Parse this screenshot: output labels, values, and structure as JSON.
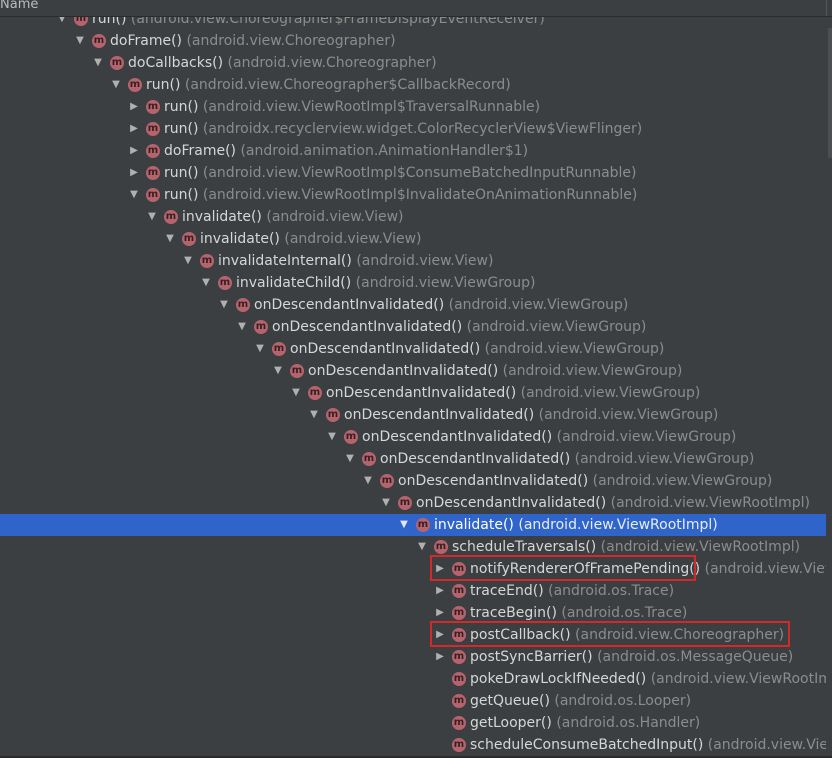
{
  "header": {
    "column": "Name"
  },
  "rows": [
    {
      "depth": 0,
      "exp": "open",
      "method": "run()",
      "cls": "(android.view.Choreographer$FrameDisplayEventReceiver)"
    },
    {
      "depth": 1,
      "exp": "open",
      "method": "doFrame()",
      "cls": "(android.view.Choreographer)"
    },
    {
      "depth": 2,
      "exp": "open",
      "method": "doCallbacks()",
      "cls": "(android.view.Choreographer)"
    },
    {
      "depth": 3,
      "exp": "open",
      "method": "run()",
      "cls": "(android.view.Choreographer$CallbackRecord)"
    },
    {
      "depth": 4,
      "exp": "closed",
      "method": "run()",
      "cls": "(android.view.ViewRootImpl$TraversalRunnable)"
    },
    {
      "depth": 4,
      "exp": "closed",
      "method": "run()",
      "cls": "(androidx.recyclerview.widget.ColorRecyclerView$ViewFlinger)"
    },
    {
      "depth": 4,
      "exp": "closed",
      "method": "doFrame()",
      "cls": "(android.animation.AnimationHandler$1)"
    },
    {
      "depth": 4,
      "exp": "closed",
      "method": "run()",
      "cls": "(android.view.ViewRootImpl$ConsumeBatchedInputRunnable)"
    },
    {
      "depth": 4,
      "exp": "open",
      "method": "run()",
      "cls": "(android.view.ViewRootImpl$InvalidateOnAnimationRunnable)"
    },
    {
      "depth": 5,
      "exp": "open",
      "method": "invalidate()",
      "cls": "(android.view.View)"
    },
    {
      "depth": 6,
      "exp": "open",
      "method": "invalidate()",
      "cls": "(android.view.View)"
    },
    {
      "depth": 7,
      "exp": "open",
      "method": "invalidateInternal()",
      "cls": "(android.view.View)"
    },
    {
      "depth": 8,
      "exp": "open",
      "method": "invalidateChild()",
      "cls": "(android.view.ViewGroup)"
    },
    {
      "depth": 9,
      "exp": "open",
      "method": "onDescendantInvalidated()",
      "cls": "(android.view.ViewGroup)"
    },
    {
      "depth": 10,
      "exp": "open",
      "method": "onDescendantInvalidated()",
      "cls": "(android.view.ViewGroup)"
    },
    {
      "depth": 11,
      "exp": "open",
      "method": "onDescendantInvalidated()",
      "cls": "(android.view.ViewGroup)"
    },
    {
      "depth": 12,
      "exp": "open",
      "method": "onDescendantInvalidated()",
      "cls": "(android.view.ViewGroup)"
    },
    {
      "depth": 13,
      "exp": "open",
      "method": "onDescendantInvalidated()",
      "cls": "(android.view.ViewGroup)"
    },
    {
      "depth": 14,
      "exp": "open",
      "method": "onDescendantInvalidated()",
      "cls": "(android.view.ViewGroup)"
    },
    {
      "depth": 15,
      "exp": "open",
      "method": "onDescendantInvalidated()",
      "cls": "(android.view.ViewGroup)"
    },
    {
      "depth": 16,
      "exp": "open",
      "method": "onDescendantInvalidated()",
      "cls": "(android.view.ViewGroup)"
    },
    {
      "depth": 17,
      "exp": "open",
      "method": "onDescendantInvalidated()",
      "cls": "(android.view.ViewGroup)"
    },
    {
      "depth": 18,
      "exp": "open",
      "method": "onDescendantInvalidated()",
      "cls": "(android.view.ViewRootImpl)"
    },
    {
      "depth": 19,
      "exp": "open",
      "method": "invalidate()",
      "cls": "(android.view.ViewRootImpl)",
      "selected": true
    },
    {
      "depth": 20,
      "exp": "open",
      "method": "scheduleTraversals()",
      "cls": "(android.view.ViewRootImpl)"
    },
    {
      "depth": 21,
      "exp": "closed",
      "method": "notifyRendererOfFramePending()",
      "cls": "(android.view.View",
      "highlight": true
    },
    {
      "depth": 21,
      "exp": "closed",
      "method": "traceEnd()",
      "cls": "(android.os.Trace)"
    },
    {
      "depth": 21,
      "exp": "closed",
      "method": "traceBegin()",
      "cls": "(android.os.Trace)"
    },
    {
      "depth": 21,
      "exp": "closed",
      "method": "postCallback()",
      "cls": "(android.view.Choreographer)",
      "highlight": true
    },
    {
      "depth": 21,
      "exp": "closed",
      "method": "postSyncBarrier()",
      "cls": "(android.os.MessageQueue)"
    },
    {
      "depth": 21,
      "exp": "none",
      "method": "pokeDrawLockIfNeeded()",
      "cls": "(android.view.ViewRootIm"
    },
    {
      "depth": 21,
      "exp": "none",
      "method": "getQueue()",
      "cls": "(android.os.Looper)"
    },
    {
      "depth": 21,
      "exp": "none",
      "method": "getLooper()",
      "cls": "(android.os.Handler)"
    },
    {
      "depth": 21,
      "exp": "none",
      "method": "scheduleConsumeBatchedInput()",
      "cls": "(android.view.View"
    }
  ],
  "icon_letter": "m",
  "colors": {
    "background": "#3c3f41",
    "selection": "#2f65ca",
    "method_icon": "#b4646d",
    "highlight_box": "#d22a2a"
  }
}
